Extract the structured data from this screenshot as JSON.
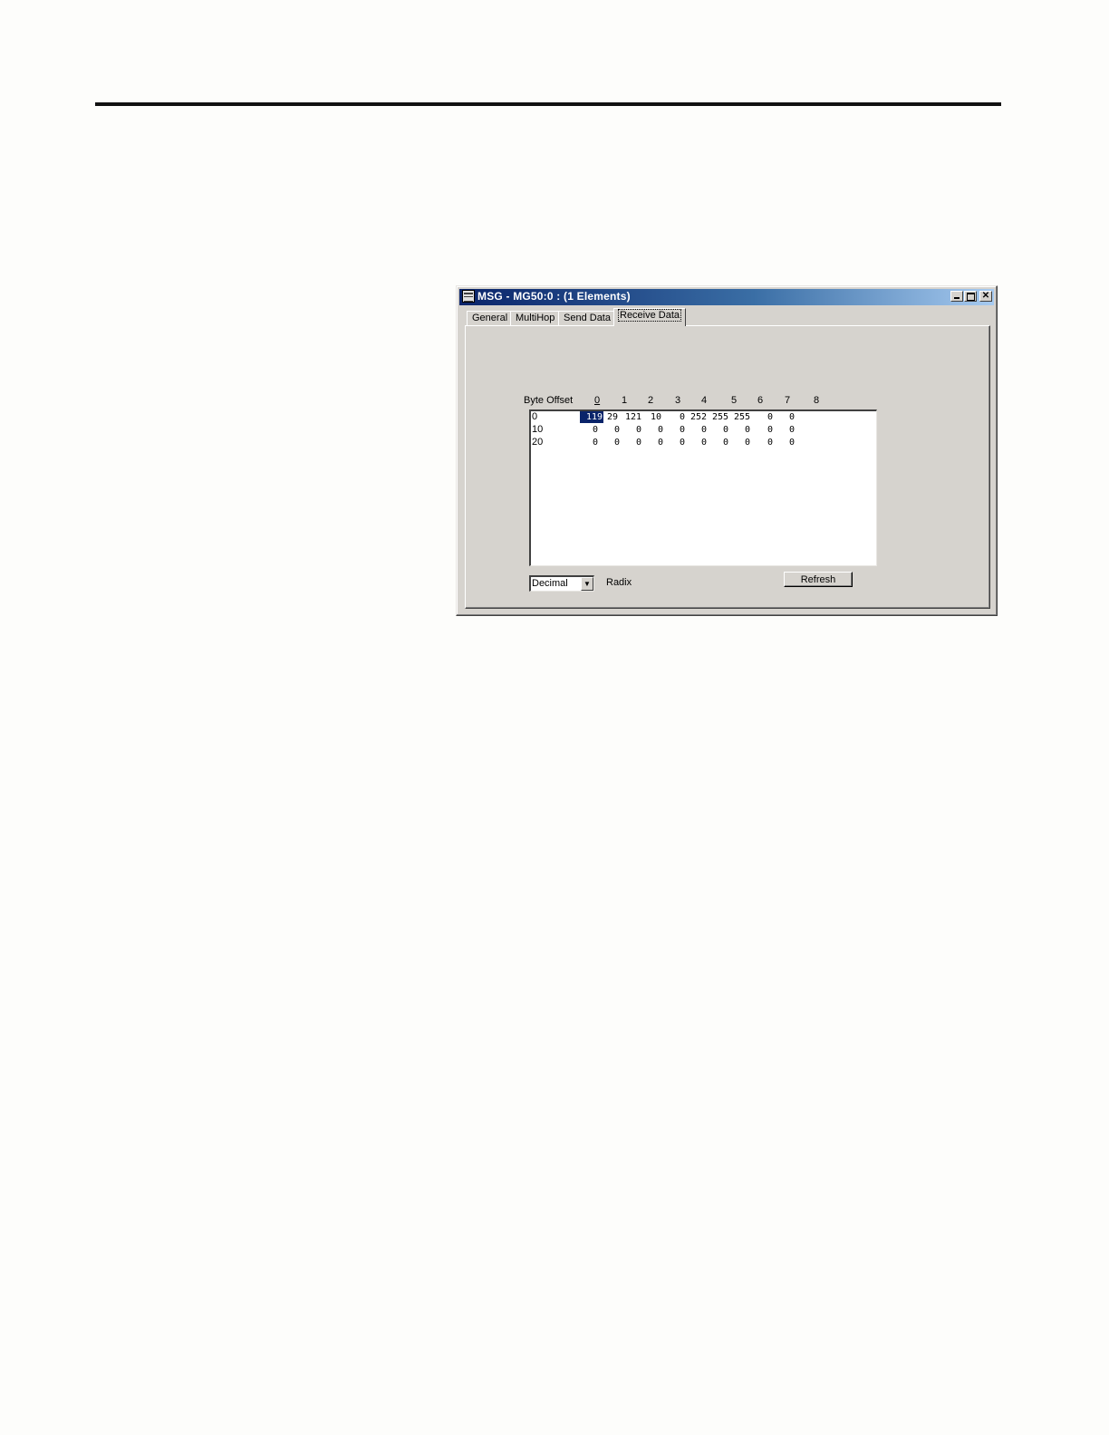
{
  "window": {
    "title": "MSG - MG50:0 : (1 Elements)"
  },
  "tabs": [
    {
      "label": "General"
    },
    {
      "label": "MultiHop"
    },
    {
      "label": "Send Data"
    },
    {
      "label": "Receive Data",
      "active": true
    }
  ],
  "grid": {
    "offset_header": "Byte Offset",
    "column_headers": [
      "0",
      "1",
      "2",
      "3",
      "4",
      "5",
      "6",
      "7",
      "8"
    ],
    "rows": [
      {
        "offset": "0",
        "values": [
          "119",
          "29",
          "121",
          "10",
          "0",
          "252",
          "255",
          "255",
          "0",
          "0"
        ],
        "selected_index": 0
      },
      {
        "offset": "10",
        "values": [
          "0",
          "0",
          "0",
          "0",
          "0",
          "0",
          "0",
          "0",
          "0",
          "0"
        ]
      },
      {
        "offset": "20",
        "values": [
          "0",
          "0",
          "0",
          "0",
          "0",
          "0",
          "0",
          "0",
          "0",
          "0"
        ]
      }
    ]
  },
  "radix": {
    "selected": "Decimal",
    "label": "Radix"
  },
  "buttons": {
    "refresh": "Refresh"
  }
}
